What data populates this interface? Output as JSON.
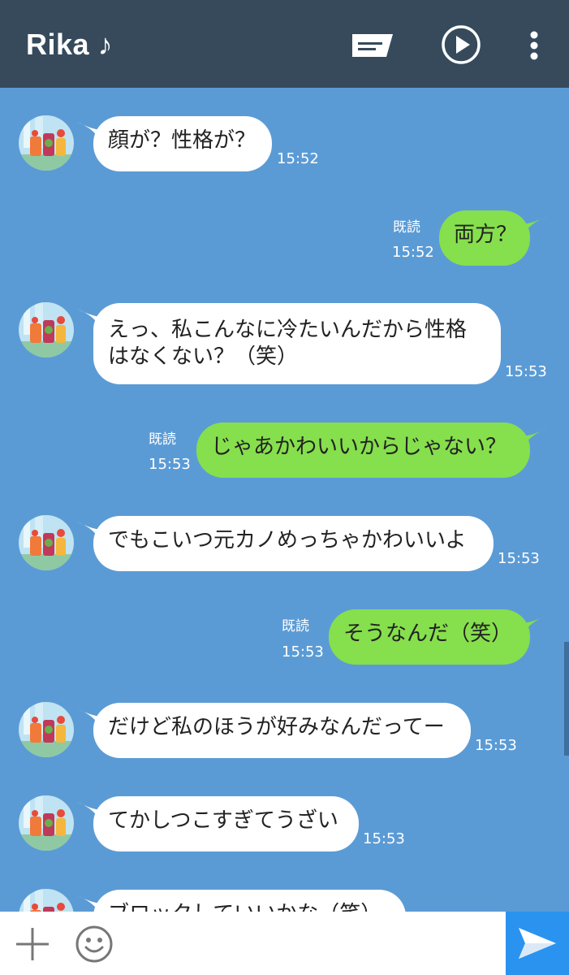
{
  "header": {
    "title": "Rika ♪",
    "icons": [
      "note-icon",
      "play-icon",
      "more-icon"
    ]
  },
  "messages": [
    {
      "side": "in",
      "text": "顔が？性格が？",
      "time": "15:52"
    },
    {
      "side": "out",
      "text": "両方？",
      "time": "15:52",
      "read": "既読"
    },
    {
      "side": "in",
      "lines": [
        "えっ、私こんなに冷たいんだから性格",
        "はなくない？（笑）"
      ],
      "time": "15:53"
    },
    {
      "side": "out",
      "text": "じゃあかわいいからじゃない？",
      "time": "15:53",
      "read": "既読"
    },
    {
      "side": "in",
      "text": "でもこいつ元カノめっちゃかわいいよ",
      "time": "15:53"
    },
    {
      "side": "out",
      "text": "そうなんだ（笑）",
      "time": "15:53",
      "read": "既読"
    },
    {
      "side": "in",
      "text": "だけど私のほうが好みなんだってー",
      "time": "15:53"
    },
    {
      "side": "in",
      "text": "てかしつこすぎてうざい",
      "time": "15:53"
    },
    {
      "side": "in",
      "text": "ブロックしていいかな（笑）",
      "time": ""
    }
  ],
  "footer": {
    "icons": [
      "plus-icon",
      "emoji-icon",
      "send-icon"
    ]
  },
  "colors": {
    "background": "#5b9bd5",
    "header": "#364a5c",
    "outgoing_bubble": "#86df4c",
    "incoming_bubble": "#ffffff",
    "send_button": "#2a93ef"
  }
}
